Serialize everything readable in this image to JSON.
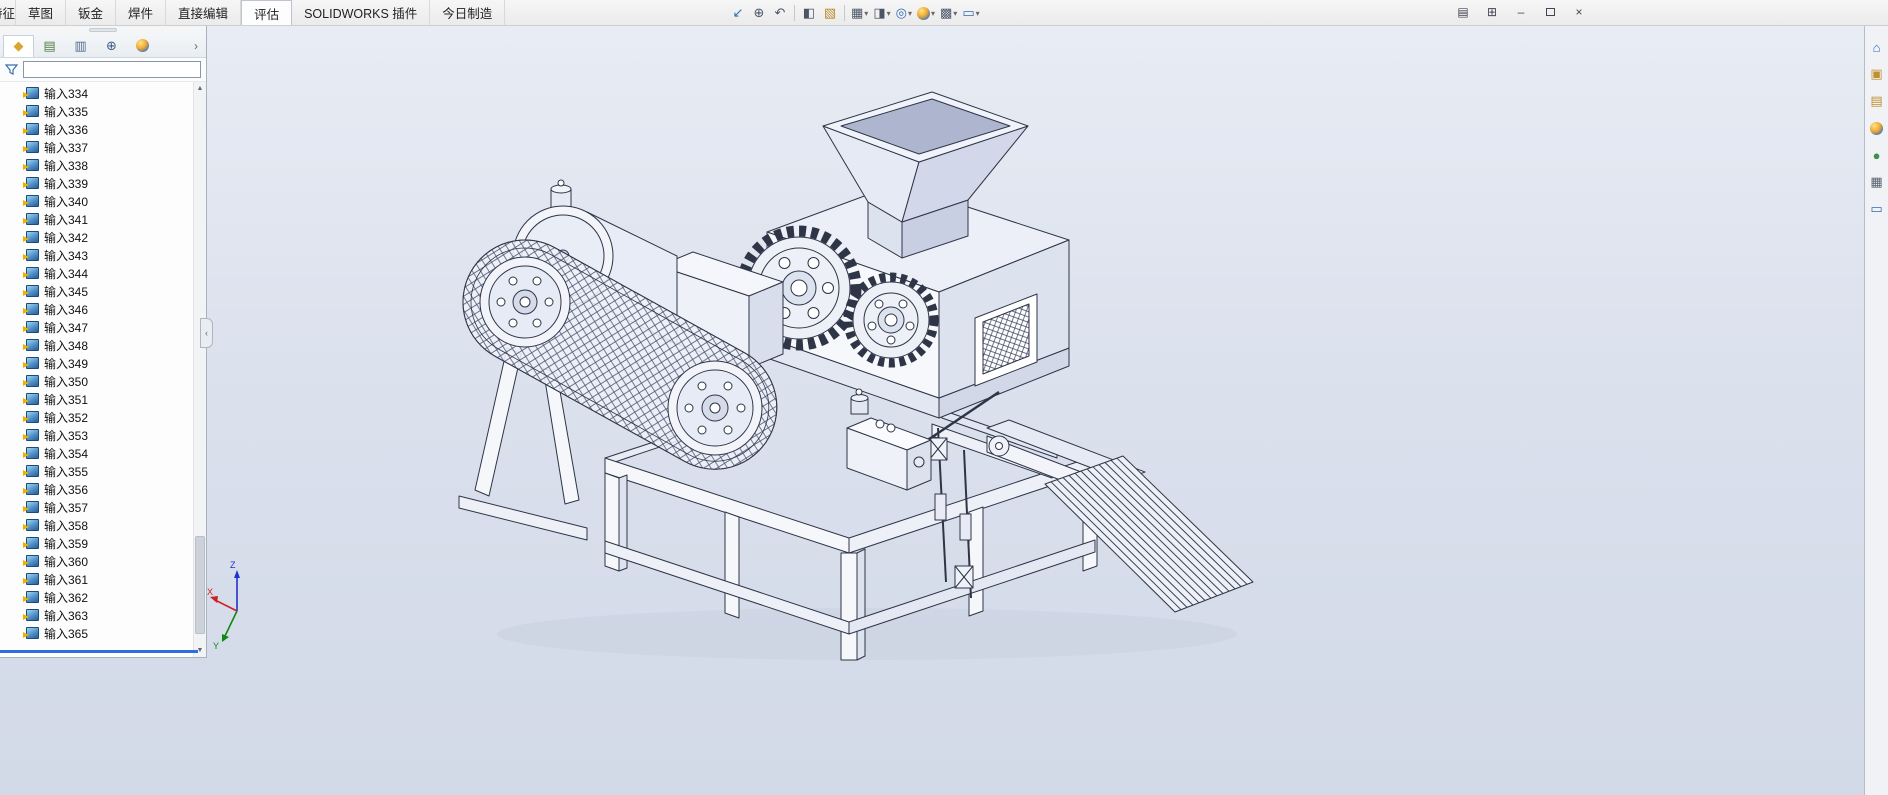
{
  "window": {
    "menu_tabs": [
      {
        "label": "特征",
        "partial": true
      },
      {
        "label": "草图"
      },
      {
        "label": "钣金"
      },
      {
        "label": "焊件"
      },
      {
        "label": "直接编辑"
      },
      {
        "label": "评估",
        "active": true
      },
      {
        "label": "SOLIDWORKS 插件"
      },
      {
        "label": "今日制造"
      }
    ],
    "window_buttons": [
      {
        "name": "file-properties-icon",
        "glyph": "▤"
      },
      {
        "name": "task-pane-toggle-icon",
        "glyph": "⊞"
      },
      {
        "name": "minimize-button",
        "glyph": "–"
      },
      {
        "name": "restore-button",
        "type": "box"
      },
      {
        "name": "close-button",
        "glyph": "×"
      }
    ]
  },
  "toolbar": {
    "icons": [
      {
        "name": "zoom-fit-icon",
        "glyph": "↙",
        "color": "#2f6db8"
      },
      {
        "name": "zoom-area-icon",
        "glyph": "⊕",
        "color": "#4a5668"
      },
      {
        "name": "previous-view-icon",
        "glyph": "↶",
        "color": "#4a5668"
      },
      {
        "name": "section-view-icon",
        "glyph": "◧",
        "color": "#4a5668",
        "sep_before": true
      },
      {
        "name": "annotations-view-icon",
        "glyph": "▧",
        "color": "#b98a2a"
      },
      {
        "name": "view-orientation-icon",
        "glyph": "▦",
        "color": "#4a5668",
        "dropdown": true,
        "sep_before": true
      },
      {
        "name": "display-style-icon",
        "glyph": "◨",
        "color": "#4a5668",
        "dropdown": true
      },
      {
        "name": "hide-show-items-icon",
        "glyph": "◎",
        "color": "#2f6db8",
        "dropdown": true
      },
      {
        "name": "edit-appearance-icon",
        "type": "ball",
        "dropdown": true
      },
      {
        "name": "apply-scene-icon",
        "glyph": "▩",
        "color": "#4a5668",
        "dropdown": true
      },
      {
        "name": "view-settings-icon",
        "glyph": "▭",
        "color": "#2f6db8",
        "dropdown": true
      }
    ]
  },
  "left_panel": {
    "tabs": [
      {
        "name": "featuremanager-tab-icon",
        "glyph": "◆",
        "color": "#d8a62e",
        "active": true
      },
      {
        "name": "propertymanager-tab-icon",
        "glyph": "▤",
        "color": "#4f7f46"
      },
      {
        "name": "configurationmanager-tab-icon",
        "glyph": "▥",
        "color": "#56698f"
      },
      {
        "name": "dimxpertmanager-tab-icon",
        "glyph": "⊕",
        "color": "#3c5d85"
      },
      {
        "name": "displaymanager-tab-icon",
        "type": "ball"
      }
    ],
    "overflow_label": "›",
    "filter": {
      "value": "",
      "placeholder": ""
    },
    "scrollbar": {
      "up": "▲",
      "down": "▼"
    },
    "tree_items": [
      "输入334",
      "输入335",
      "输入336",
      "输入337",
      "输入338",
      "输入339",
      "输入340",
      "输入341",
      "输入342",
      "输入343",
      "输入344",
      "输入345",
      "输入346",
      "输入347",
      "输入348",
      "输入349",
      "输入350",
      "输入351",
      "输入352",
      "输入353",
      "输入354",
      "输入355",
      "输入356",
      "输入357",
      "输入358",
      "输入359",
      "输入360",
      "输入361",
      "输入362",
      "输入363",
      "输入365"
    ]
  },
  "task_pane": {
    "icons": [
      {
        "name": "solidworks-resources-icon",
        "glyph": "⌂",
        "color": "#2f6db8"
      },
      {
        "name": "design-library-icon",
        "glyph": "▣",
        "color": "#c08f2f"
      },
      {
        "name": "file-explorer-icon",
        "glyph": "▤",
        "color": "#c08f2f"
      },
      {
        "name": "view-palette-icon",
        "type": "ball"
      },
      {
        "name": "appearances-icon",
        "glyph": "●",
        "color": "#3f8f4f"
      },
      {
        "name": "custom-properties-icon",
        "glyph": "▦",
        "color": "#56606e"
      },
      {
        "name": "forum-icon",
        "glyph": "▭",
        "color": "#2f6db8"
      }
    ]
  },
  "viewport": {
    "triad": {
      "x": "X",
      "y": "Y",
      "z": "Z"
    }
  },
  "flyout_handle_glyph": "‹"
}
